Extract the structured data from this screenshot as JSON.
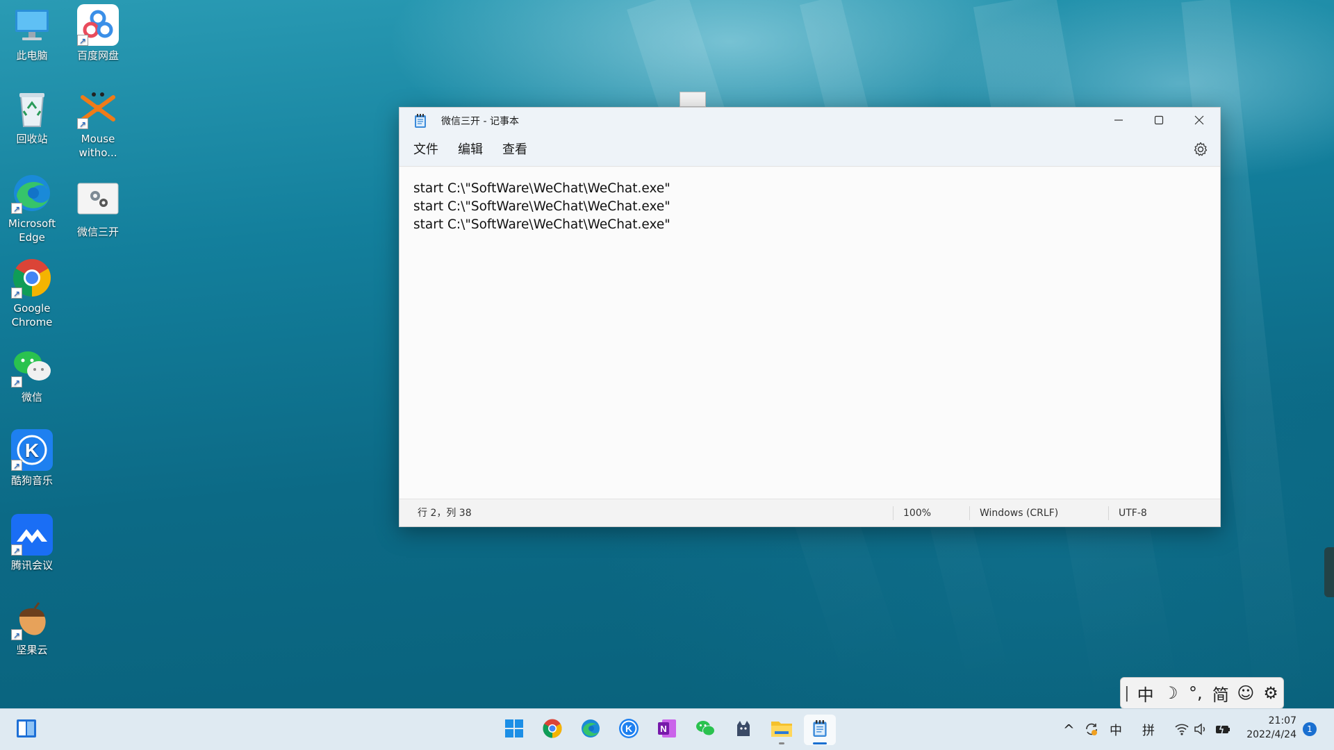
{
  "desktop": {
    "icons": [
      {
        "label": "此电脑",
        "icon": "computer-icon"
      },
      {
        "label": "百度网盘",
        "icon": "baidu-netdisk-icon"
      },
      {
        "label": "回收站",
        "icon": "recycle-bin-icon"
      },
      {
        "label": "Mouse witho...",
        "icon": "mouse-without-borders-icon"
      },
      {
        "label": "Microsoft Edge",
        "icon": "edge-icon"
      },
      {
        "label": "微信三开",
        "icon": "batch-file-icon"
      },
      {
        "label": "Google Chrome",
        "icon": "chrome-icon"
      },
      {
        "label": "微信",
        "icon": "wechat-icon"
      },
      {
        "label": "酷狗音乐",
        "icon": "kugou-icon"
      },
      {
        "label": "腾讯会议",
        "icon": "tencent-meeting-icon"
      },
      {
        "label": "坚果云",
        "icon": "jianguoyun-icon"
      }
    ]
  },
  "notepad": {
    "title": "微信三开 - 记事本",
    "menu": [
      "文件",
      "编辑",
      "查看"
    ],
    "lines": [
      "start C:\\\"SoftWare\\WeChat\\WeChat.exe\"",
      "start C:\\\"SoftWare\\WeChat\\WeChat.exe\"",
      "start C:\\\"SoftWare\\WeChat\\WeChat.exe\""
    ],
    "status": {
      "position": "行 2，列 38",
      "zoom": "100%",
      "line_ending": "Windows (CRLF)",
      "encoding": "UTF-8"
    }
  },
  "ime_bar": {
    "items": [
      "中",
      "☽",
      "°,",
      "简",
      "☺",
      "⚙"
    ]
  },
  "taskbar": {
    "apps": [
      "start-icon",
      "chrome-icon",
      "edge-icon",
      "kugou-icon",
      "onenote-icon",
      "wechat-icon",
      "cat-app-icon",
      "file-explorer-icon",
      "notepad-icon"
    ],
    "tray": {
      "chevron": "^",
      "ime_lang": "中",
      "ime_mode": "拼"
    },
    "clock": {
      "time": "21:07",
      "date": "2022/4/24"
    },
    "notification_count": "1"
  },
  "colors": {
    "accent": "#1a6fd0",
    "window_chrome": "#eef3f8",
    "taskbar": "#dfeaf2"
  }
}
